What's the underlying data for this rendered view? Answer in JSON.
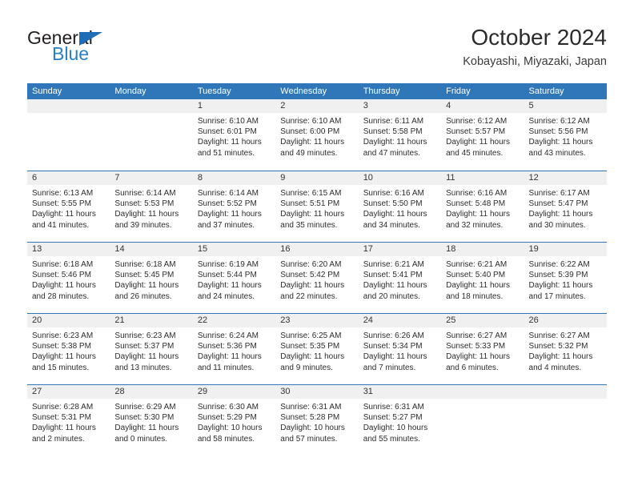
{
  "brand": {
    "name_dark": "General",
    "name_blue": "Blue",
    "accent_color": "#2980c9",
    "triangle_color": "#1f6db5"
  },
  "header": {
    "title": "October 2024",
    "subtitle": "Kobayashi, Miyazaki, Japan"
  },
  "theme": {
    "header_bar_color": "#2f77b8",
    "day_band_color": "#f0f0f0",
    "week_separator_color": "#2f77b8",
    "text_color": "#2c2c2c"
  },
  "weekdays": [
    "Sunday",
    "Monday",
    "Tuesday",
    "Wednesday",
    "Thursday",
    "Friday",
    "Saturday"
  ],
  "weeks": [
    [
      {
        "day": "",
        "empty": true,
        "sunrise": "",
        "sunset": "",
        "daylight1": "",
        "daylight2": ""
      },
      {
        "day": "",
        "empty": true,
        "sunrise": "",
        "sunset": "",
        "daylight1": "",
        "daylight2": ""
      },
      {
        "day": "1",
        "empty": false,
        "sunrise": "Sunrise: 6:10 AM",
        "sunset": "Sunset: 6:01 PM",
        "daylight1": "Daylight: 11 hours",
        "daylight2": "and 51 minutes."
      },
      {
        "day": "2",
        "empty": false,
        "sunrise": "Sunrise: 6:10 AM",
        "sunset": "Sunset: 6:00 PM",
        "daylight1": "Daylight: 11 hours",
        "daylight2": "and 49 minutes."
      },
      {
        "day": "3",
        "empty": false,
        "sunrise": "Sunrise: 6:11 AM",
        "sunset": "Sunset: 5:58 PM",
        "daylight1": "Daylight: 11 hours",
        "daylight2": "and 47 minutes."
      },
      {
        "day": "4",
        "empty": false,
        "sunrise": "Sunrise: 6:12 AM",
        "sunset": "Sunset: 5:57 PM",
        "daylight1": "Daylight: 11 hours",
        "daylight2": "and 45 minutes."
      },
      {
        "day": "5",
        "empty": false,
        "sunrise": "Sunrise: 6:12 AM",
        "sunset": "Sunset: 5:56 PM",
        "daylight1": "Daylight: 11 hours",
        "daylight2": "and 43 minutes."
      }
    ],
    [
      {
        "day": "6",
        "empty": false,
        "sunrise": "Sunrise: 6:13 AM",
        "sunset": "Sunset: 5:55 PM",
        "daylight1": "Daylight: 11 hours",
        "daylight2": "and 41 minutes."
      },
      {
        "day": "7",
        "empty": false,
        "sunrise": "Sunrise: 6:14 AM",
        "sunset": "Sunset: 5:53 PM",
        "daylight1": "Daylight: 11 hours",
        "daylight2": "and 39 minutes."
      },
      {
        "day": "8",
        "empty": false,
        "sunrise": "Sunrise: 6:14 AM",
        "sunset": "Sunset: 5:52 PM",
        "daylight1": "Daylight: 11 hours",
        "daylight2": "and 37 minutes."
      },
      {
        "day": "9",
        "empty": false,
        "sunrise": "Sunrise: 6:15 AM",
        "sunset": "Sunset: 5:51 PM",
        "daylight1": "Daylight: 11 hours",
        "daylight2": "and 35 minutes."
      },
      {
        "day": "10",
        "empty": false,
        "sunrise": "Sunrise: 6:16 AM",
        "sunset": "Sunset: 5:50 PM",
        "daylight1": "Daylight: 11 hours",
        "daylight2": "and 34 minutes."
      },
      {
        "day": "11",
        "empty": false,
        "sunrise": "Sunrise: 6:16 AM",
        "sunset": "Sunset: 5:48 PM",
        "daylight1": "Daylight: 11 hours",
        "daylight2": "and 32 minutes."
      },
      {
        "day": "12",
        "empty": false,
        "sunrise": "Sunrise: 6:17 AM",
        "sunset": "Sunset: 5:47 PM",
        "daylight1": "Daylight: 11 hours",
        "daylight2": "and 30 minutes."
      }
    ],
    [
      {
        "day": "13",
        "empty": false,
        "sunrise": "Sunrise: 6:18 AM",
        "sunset": "Sunset: 5:46 PM",
        "daylight1": "Daylight: 11 hours",
        "daylight2": "and 28 minutes."
      },
      {
        "day": "14",
        "empty": false,
        "sunrise": "Sunrise: 6:18 AM",
        "sunset": "Sunset: 5:45 PM",
        "daylight1": "Daylight: 11 hours",
        "daylight2": "and 26 minutes."
      },
      {
        "day": "15",
        "empty": false,
        "sunrise": "Sunrise: 6:19 AM",
        "sunset": "Sunset: 5:44 PM",
        "daylight1": "Daylight: 11 hours",
        "daylight2": "and 24 minutes."
      },
      {
        "day": "16",
        "empty": false,
        "sunrise": "Sunrise: 6:20 AM",
        "sunset": "Sunset: 5:42 PM",
        "daylight1": "Daylight: 11 hours",
        "daylight2": "and 22 minutes."
      },
      {
        "day": "17",
        "empty": false,
        "sunrise": "Sunrise: 6:21 AM",
        "sunset": "Sunset: 5:41 PM",
        "daylight1": "Daylight: 11 hours",
        "daylight2": "and 20 minutes."
      },
      {
        "day": "18",
        "empty": false,
        "sunrise": "Sunrise: 6:21 AM",
        "sunset": "Sunset: 5:40 PM",
        "daylight1": "Daylight: 11 hours",
        "daylight2": "and 18 minutes."
      },
      {
        "day": "19",
        "empty": false,
        "sunrise": "Sunrise: 6:22 AM",
        "sunset": "Sunset: 5:39 PM",
        "daylight1": "Daylight: 11 hours",
        "daylight2": "and 17 minutes."
      }
    ],
    [
      {
        "day": "20",
        "empty": false,
        "sunrise": "Sunrise: 6:23 AM",
        "sunset": "Sunset: 5:38 PM",
        "daylight1": "Daylight: 11 hours",
        "daylight2": "and 15 minutes."
      },
      {
        "day": "21",
        "empty": false,
        "sunrise": "Sunrise: 6:23 AM",
        "sunset": "Sunset: 5:37 PM",
        "daylight1": "Daylight: 11 hours",
        "daylight2": "and 13 minutes."
      },
      {
        "day": "22",
        "empty": false,
        "sunrise": "Sunrise: 6:24 AM",
        "sunset": "Sunset: 5:36 PM",
        "daylight1": "Daylight: 11 hours",
        "daylight2": "and 11 minutes."
      },
      {
        "day": "23",
        "empty": false,
        "sunrise": "Sunrise: 6:25 AM",
        "sunset": "Sunset: 5:35 PM",
        "daylight1": "Daylight: 11 hours",
        "daylight2": "and 9 minutes."
      },
      {
        "day": "24",
        "empty": false,
        "sunrise": "Sunrise: 6:26 AM",
        "sunset": "Sunset: 5:34 PM",
        "daylight1": "Daylight: 11 hours",
        "daylight2": "and 7 minutes."
      },
      {
        "day": "25",
        "empty": false,
        "sunrise": "Sunrise: 6:27 AM",
        "sunset": "Sunset: 5:33 PM",
        "daylight1": "Daylight: 11 hours",
        "daylight2": "and 6 minutes."
      },
      {
        "day": "26",
        "empty": false,
        "sunrise": "Sunrise: 6:27 AM",
        "sunset": "Sunset: 5:32 PM",
        "daylight1": "Daylight: 11 hours",
        "daylight2": "and 4 minutes."
      }
    ],
    [
      {
        "day": "27",
        "empty": false,
        "sunrise": "Sunrise: 6:28 AM",
        "sunset": "Sunset: 5:31 PM",
        "daylight1": "Daylight: 11 hours",
        "daylight2": "and 2 minutes."
      },
      {
        "day": "28",
        "empty": false,
        "sunrise": "Sunrise: 6:29 AM",
        "sunset": "Sunset: 5:30 PM",
        "daylight1": "Daylight: 11 hours",
        "daylight2": "and 0 minutes."
      },
      {
        "day": "29",
        "empty": false,
        "sunrise": "Sunrise: 6:30 AM",
        "sunset": "Sunset: 5:29 PM",
        "daylight1": "Daylight: 10 hours",
        "daylight2": "and 58 minutes."
      },
      {
        "day": "30",
        "empty": false,
        "sunrise": "Sunrise: 6:31 AM",
        "sunset": "Sunset: 5:28 PM",
        "daylight1": "Daylight: 10 hours",
        "daylight2": "and 57 minutes."
      },
      {
        "day": "31",
        "empty": false,
        "sunrise": "Sunrise: 6:31 AM",
        "sunset": "Sunset: 5:27 PM",
        "daylight1": "Daylight: 10 hours",
        "daylight2": "and 55 minutes."
      },
      {
        "day": "",
        "empty": true,
        "sunrise": "",
        "sunset": "",
        "daylight1": "",
        "daylight2": ""
      },
      {
        "day": "",
        "empty": true,
        "sunrise": "",
        "sunset": "",
        "daylight1": "",
        "daylight2": ""
      }
    ]
  ]
}
